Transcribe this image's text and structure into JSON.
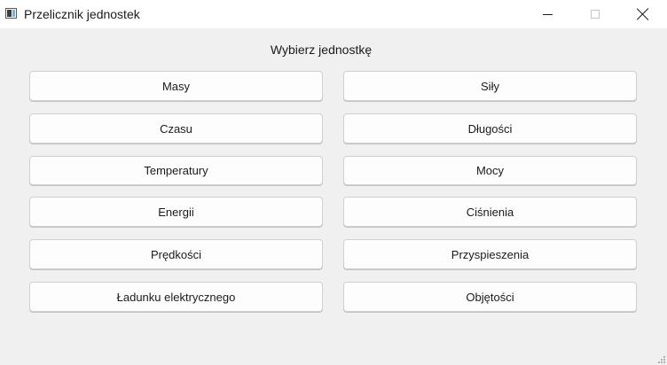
{
  "window": {
    "title": "Przelicznik jednostek",
    "controls": {
      "minimize": "minimize",
      "maximize": "maximize",
      "close": "close"
    }
  },
  "main": {
    "heading": "Wybierz jednostkę",
    "buttons": {
      "masy": "Masy",
      "sily": "Siły",
      "czasu": "Czasu",
      "dlugosci": "Długości",
      "temperatury": "Temperatury",
      "mocy": "Mocy",
      "energii": "Energii",
      "cisnienia": "Ciśnienia",
      "predkosci": "Prędkości",
      "przyspieszenia": "Przyspieszenia",
      "ladunku": "Ładunku elektrycznego",
      "objetosci": "Objętości"
    }
  }
}
